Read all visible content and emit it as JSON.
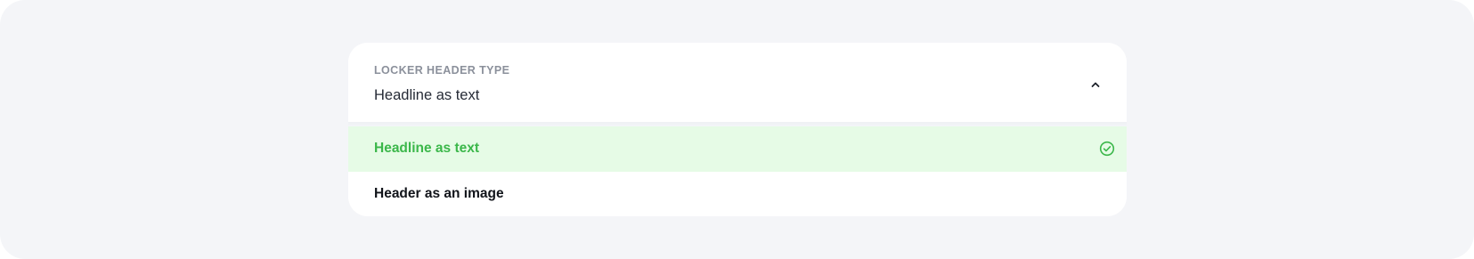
{
  "dropdown": {
    "label": "LOCKER HEADER TYPE",
    "value": "Headline as text",
    "toggle_icon": "chevron-up-icon",
    "options": [
      {
        "label": "Headline as text",
        "selected": true,
        "icon": "check-circle-icon"
      },
      {
        "label": "Header as an image",
        "selected": false
      }
    ]
  },
  "colors": {
    "page_background": "#f4f5f8",
    "panel_background": "#ffffff",
    "selected_background": "#e6fbe6",
    "selected_text": "#3bb74a",
    "label_text": "#8b909b",
    "value_text": "#262b36"
  }
}
